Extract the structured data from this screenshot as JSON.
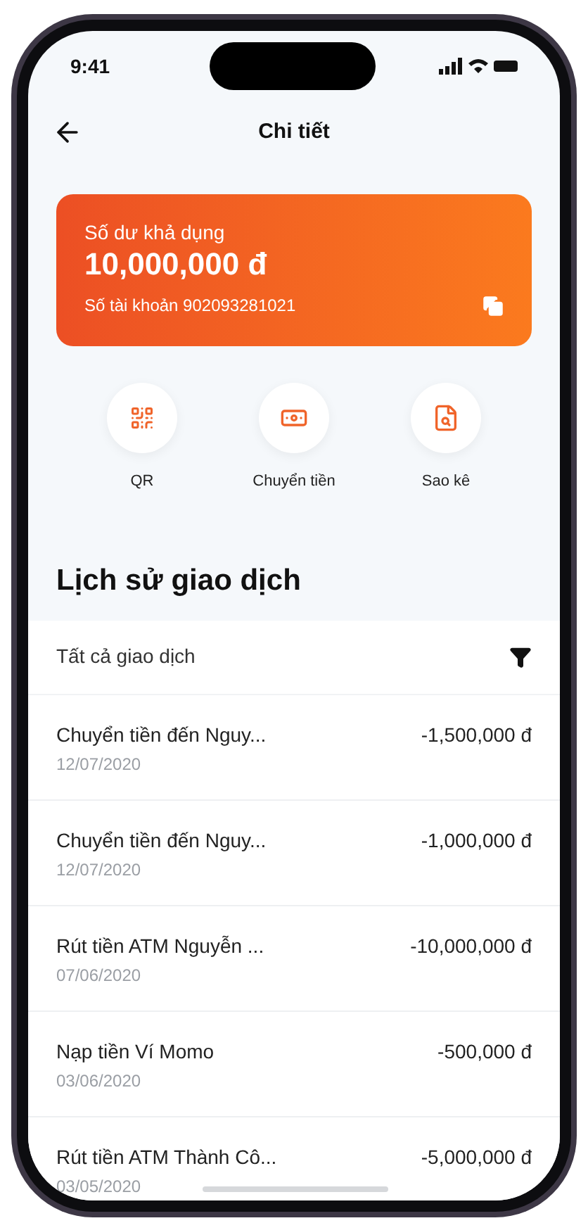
{
  "status_bar": {
    "time": "9:41"
  },
  "header": {
    "title": "Chi tiết"
  },
  "balance_card": {
    "label": "Số dư khả dụng",
    "amount": "10,000,000 đ",
    "account": "Số tài khoản 902093281021"
  },
  "actions": [
    {
      "kind": "qr",
      "label": "QR"
    },
    {
      "kind": "transfer",
      "label": "Chuyển tiền"
    },
    {
      "kind": "statement",
      "label": "Sao kê"
    }
  ],
  "history": {
    "title": "Lịch sử giao dịch",
    "filter": "Tất cả giao dịch",
    "transactions": [
      {
        "name": "Chuyển tiền đến Nguy...",
        "date": "12/07/2020",
        "amount": "-1,500,000 đ"
      },
      {
        "name": "Chuyển tiền đến Nguy...",
        "date": "12/07/2020",
        "amount": "-1,000,000 đ"
      },
      {
        "name": "Rút tiền ATM Nguyễn ...",
        "date": "07/06/2020",
        "amount": "-10,000,000 đ"
      },
      {
        "name": "Nạp tiền Ví Momo",
        "date": "03/06/2020",
        "amount": "-500,000 đ"
      },
      {
        "name": "Rút tiền ATM Thành Cô...",
        "date": "03/05/2020",
        "amount": "-5,000,000 đ"
      }
    ]
  }
}
